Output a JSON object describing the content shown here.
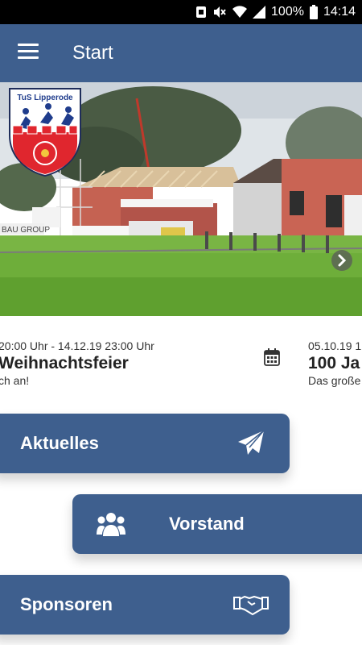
{
  "status_bar": {
    "battery": "100%",
    "time": "14:14"
  },
  "app_bar": {
    "title": "Start"
  },
  "hero": {
    "club_name": "TuS Lipperode",
    "sign_text": "BAU GROUP"
  },
  "events": [
    {
      "datetime": "20:00 Uhr - 14.12.19 23:00 Uhr",
      "title": "Weihnachtsfeier",
      "subtitle": "ch an!"
    },
    {
      "datetime": "05.10.19 1",
      "title": "100 Ja",
      "subtitle": "Das große"
    }
  ],
  "menu_buttons": [
    {
      "label": "Aktuelles",
      "icon": "paper-plane-icon"
    },
    {
      "label": "Vorstand",
      "icon": "group-icon"
    },
    {
      "label": "Sponsoren",
      "icon": "handshake-icon"
    }
  ],
  "colors": {
    "primary": "#3e5f8e",
    "status_bar": "#000000"
  }
}
